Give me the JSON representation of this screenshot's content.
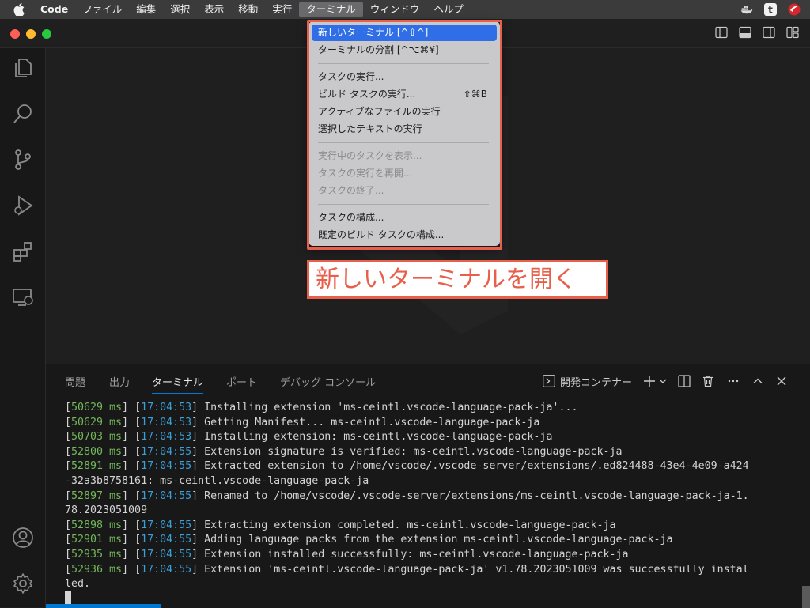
{
  "menubar": {
    "app": "Code",
    "items": [
      "ファイル",
      "編集",
      "選択",
      "表示",
      "移動",
      "実行",
      "ターミナル",
      "ウィンドウ",
      "ヘルプ"
    ],
    "active_index": 6,
    "status_icons": [
      "docker-icon",
      "t-app-icon",
      "security-icon"
    ]
  },
  "dropdown": {
    "items": [
      {
        "label": "新しいターミナル [^⇧^]",
        "shortcut": "",
        "highlighted": true,
        "disabled": false
      },
      {
        "label": "ターミナルの分割 [^⌥⌘¥]",
        "shortcut": "",
        "highlighted": false,
        "disabled": false
      },
      {
        "separator": true
      },
      {
        "label": "タスクの実行...",
        "shortcut": "",
        "disabled": false
      },
      {
        "label": "ビルド タスクの実行...",
        "shortcut": "⇧⌘B",
        "disabled": false
      },
      {
        "label": "アクティブなファイルの実行",
        "shortcut": "",
        "disabled": false
      },
      {
        "label": "選択したテキストの実行",
        "shortcut": "",
        "disabled": false
      },
      {
        "separator": true
      },
      {
        "label": "実行中のタスクを表示...",
        "shortcut": "",
        "disabled": true
      },
      {
        "label": "タスクの実行を再開...",
        "shortcut": "",
        "disabled": true
      },
      {
        "label": "タスクの終了...",
        "shortcut": "",
        "disabled": true
      },
      {
        "separator": true
      },
      {
        "label": "タスクの構成...",
        "shortcut": "",
        "disabled": false
      },
      {
        "label": "既定のビルド タスクの構成...",
        "shortcut": "",
        "disabled": false
      }
    ]
  },
  "callout": "新しいターミナルを開く",
  "panel": {
    "tabs": [
      "問題",
      "出力",
      "ターミナル",
      "ポート",
      "デバッグ コンソール"
    ],
    "active_tab": 2,
    "terminal_name": "開発コンテナー"
  },
  "terminal_lines": [
    {
      "ms": "50629",
      "time": "17:04:53",
      "text": "Installing extension 'ms-ceintl.vscode-language-pack-ja'..."
    },
    {
      "ms": "50629",
      "time": "17:04:53",
      "text": "Getting Manifest... ms-ceintl.vscode-language-pack-ja"
    },
    {
      "ms": "50703",
      "time": "17:04:53",
      "text": "Installing extension: ms-ceintl.vscode-language-pack-ja"
    },
    {
      "ms": "52800",
      "time": "17:04:55",
      "text": "Extension signature is verified: ms-ceintl.vscode-language-pack-ja"
    },
    {
      "ms": "52891",
      "time": "17:04:55",
      "text": "Extracted extension to /home/vscode/.vscode-server/extensions/.ed824488-43e4-4e09-a424",
      "cont": "-32a3b8758161: ms-ceintl.vscode-language-pack-ja"
    },
    {
      "ms": "52897",
      "time": "17:04:55",
      "text": "Renamed to /home/vscode/.vscode-server/extensions/ms-ceintl.vscode-language-pack-ja-1.",
      "cont": "78.2023051009"
    },
    {
      "ms": "52898",
      "time": "17:04:55",
      "text": "Extracting extension completed. ms-ceintl.vscode-language-pack-ja"
    },
    {
      "ms": "52901",
      "time": "17:04:55",
      "text": "Adding language packs from the extension ms-ceintl.vscode-language-pack-ja"
    },
    {
      "ms": "52935",
      "time": "17:04:55",
      "text": "Extension installed successfully: ms-ceintl.vscode-language-pack-ja"
    },
    {
      "ms": "52936",
      "time": "17:04:55",
      "text": "Extension 'ms-ceintl.vscode-language-pack-ja' v1.78.2023051009 was successfully instal",
      "cont": "led."
    }
  ],
  "colors": {
    "accent": "#0078d4",
    "highlight": "#2f6ee6",
    "annotation": "#e8604c",
    "ms": "#73b85a",
    "time": "#3aa0d8"
  }
}
